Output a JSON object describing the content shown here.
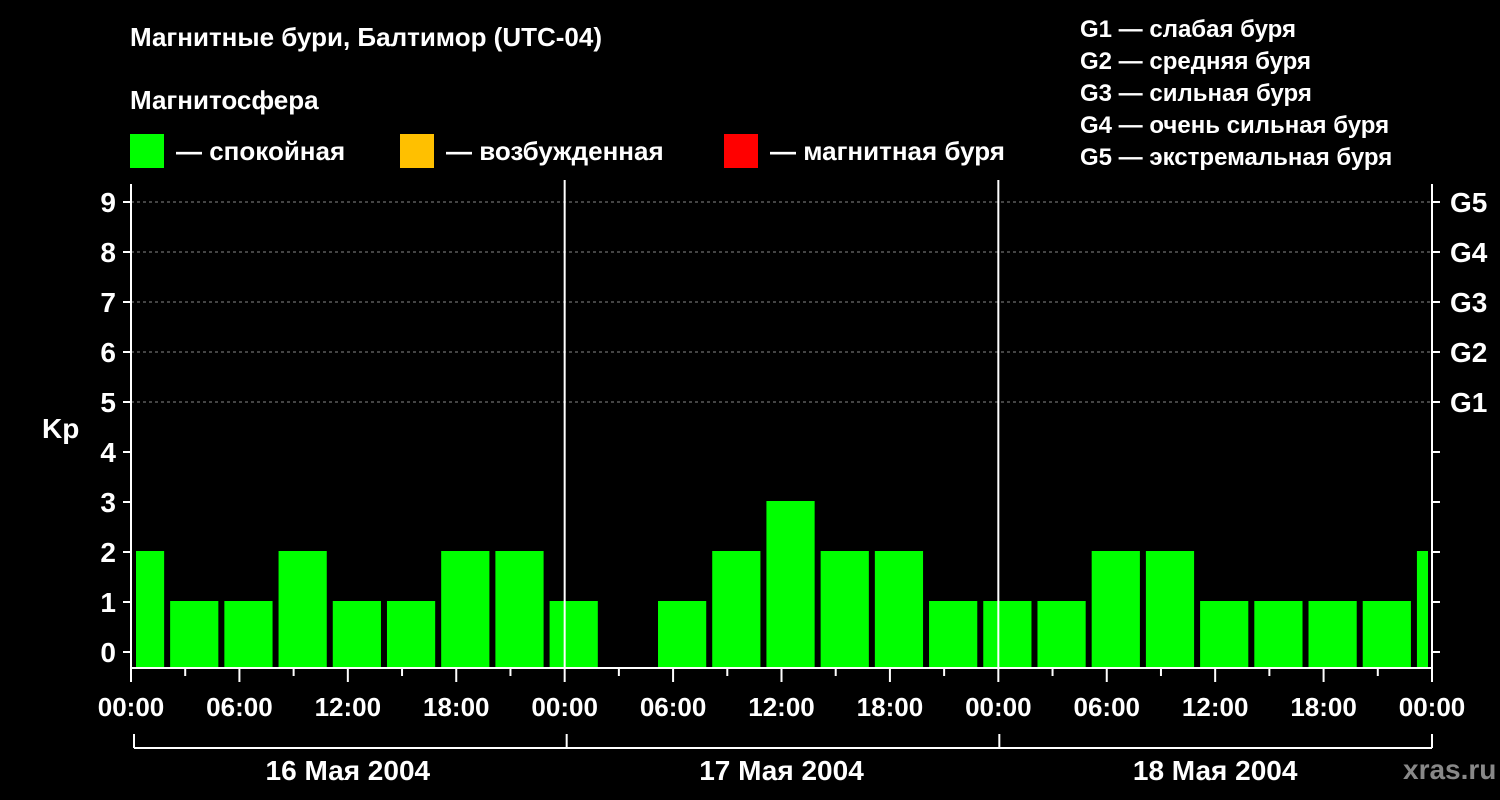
{
  "title": "Магнитные бури, Балтимор (UTC-04)",
  "magnetosphere_heading": "Магнитосфера",
  "legend": [
    {
      "color": "#00ff00",
      "label": "— спокойная"
    },
    {
      "color": "#ffc000",
      "label": "— возбужденная"
    },
    {
      "color": "#ff0000",
      "label": "— магнитная буря"
    }
  ],
  "g_scale": [
    "G1 — слабая буря",
    "G2 — средняя буря",
    "G3 — сильная буря",
    "G4 — очень сильная буря",
    "G5 — экстремальная буря"
  ],
  "watermark": "xras.ru",
  "chart_data": {
    "type": "bar",
    "ylabel": "Kp",
    "ylim": [
      0,
      9
    ],
    "yticks": [
      "0",
      "1",
      "2",
      "3",
      "4",
      "5",
      "6",
      "7",
      "8",
      "9"
    ],
    "right_ticks": [
      {
        "value": 5,
        "label": "G1"
      },
      {
        "value": 6,
        "label": "G2"
      },
      {
        "value": 7,
        "label": "G3"
      },
      {
        "value": 8,
        "label": "G4"
      },
      {
        "value": 9,
        "label": "G5"
      }
    ],
    "grid": "horizontal dashed at Kp 5-9",
    "x_start": "2004-05-16 00:00",
    "x_end": "2004-05-19 00:00",
    "xtick_labels": [
      "00:00",
      "06:00",
      "12:00",
      "18:00",
      "00:00",
      "06:00",
      "12:00",
      "18:00",
      "00:00",
      "06:00",
      "12:00",
      "18:00",
      "00:00"
    ],
    "day_labels": [
      "16 Мая 2004",
      "17 Мая 2004",
      "18 Мая 2004"
    ],
    "bar_color": "#00ff00",
    "bars": [
      {
        "start": "2004-05-15 23:00",
        "end": "2004-05-16 02:00",
        "kp": 2
      },
      {
        "start": "2004-05-16 02:00",
        "end": "2004-05-16 05:00",
        "kp": 1
      },
      {
        "start": "2004-05-16 05:00",
        "end": "2004-05-16 08:00",
        "kp": 1
      },
      {
        "start": "2004-05-16 08:00",
        "end": "2004-05-16 11:00",
        "kp": 2
      },
      {
        "start": "2004-05-16 11:00",
        "end": "2004-05-16 14:00",
        "kp": 1
      },
      {
        "start": "2004-05-16 14:00",
        "end": "2004-05-16 17:00",
        "kp": 1
      },
      {
        "start": "2004-05-16 17:00",
        "end": "2004-05-16 20:00",
        "kp": 2
      },
      {
        "start": "2004-05-16 20:00",
        "end": "2004-05-16 23:00",
        "kp": 2
      },
      {
        "start": "2004-05-16 23:00",
        "end": "2004-05-17 02:00",
        "kp": 1
      },
      {
        "start": "2004-05-17 02:00",
        "end": "2004-05-17 05:00",
        "kp": 0
      },
      {
        "start": "2004-05-17 05:00",
        "end": "2004-05-17 08:00",
        "kp": 1
      },
      {
        "start": "2004-05-17 08:00",
        "end": "2004-05-17 11:00",
        "kp": 2
      },
      {
        "start": "2004-05-17 11:00",
        "end": "2004-05-17 14:00",
        "kp": 3
      },
      {
        "start": "2004-05-17 14:00",
        "end": "2004-05-17 17:00",
        "kp": 2
      },
      {
        "start": "2004-05-17 17:00",
        "end": "2004-05-17 20:00",
        "kp": 2
      },
      {
        "start": "2004-05-17 20:00",
        "end": "2004-05-17 23:00",
        "kp": 1
      },
      {
        "start": "2004-05-17 23:00",
        "end": "2004-05-18 02:00",
        "kp": 1
      },
      {
        "start": "2004-05-18 02:00",
        "end": "2004-05-18 05:00",
        "kp": 1
      },
      {
        "start": "2004-05-18 05:00",
        "end": "2004-05-18 08:00",
        "kp": 2
      },
      {
        "start": "2004-05-18 08:00",
        "end": "2004-05-18 11:00",
        "kp": 2
      },
      {
        "start": "2004-05-18 11:00",
        "end": "2004-05-18 14:00",
        "kp": 1
      },
      {
        "start": "2004-05-18 14:00",
        "end": "2004-05-18 17:00",
        "kp": 1
      },
      {
        "start": "2004-05-18 17:00",
        "end": "2004-05-18 20:00",
        "kp": 1
      },
      {
        "start": "2004-05-18 20:00",
        "end": "2004-05-18 23:00",
        "kp": 1
      },
      {
        "start": "2004-05-18 23:00",
        "end": "2004-05-19 02:00",
        "kp": 2
      }
    ]
  }
}
